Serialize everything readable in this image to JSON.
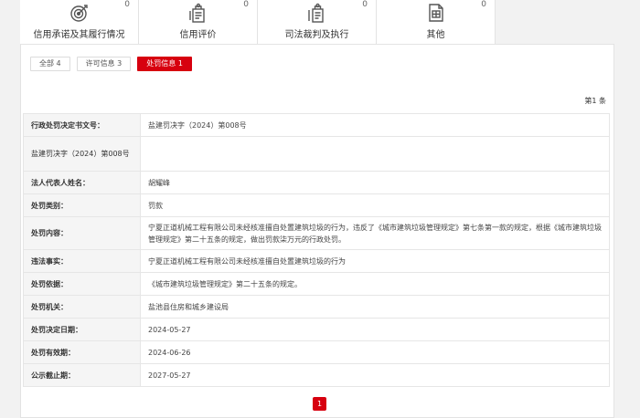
{
  "categories": [
    {
      "label": "信用承诺及其履行情况",
      "count": "0",
      "icon": "commitment-icon"
    },
    {
      "label": "信用评价",
      "count": "0",
      "icon": "evaluation-icon"
    },
    {
      "label": "司法裁判及执行",
      "count": "0",
      "icon": "judicial-icon"
    },
    {
      "label": "其他",
      "count": "0",
      "icon": "other-icon"
    }
  ],
  "filters": [
    {
      "label": "全部 4",
      "active": false
    },
    {
      "label": "许可信息 3",
      "active": false
    },
    {
      "label": "处罚信息 1",
      "active": true
    }
  ],
  "page_info": "第1 条",
  "details": {
    "decision_no_label": "行政处罚决定书文号：",
    "decision_no_value": "盐建罚决字（2024）第008号",
    "sub_row_text": "盐建罚决字（2024）第008号",
    "legal_rep_label": "法人代表人姓名：",
    "legal_rep_value": "胡耀峰",
    "category_label": "处罚类别：",
    "category_value": "罚款",
    "content_label": "处罚内容：",
    "content_value": "宁夏正道机械工程有限公司未经核准擅自处置建筑垃圾的行为，违反了《城市建筑垃圾管理规定》第七条第一款的规定，根据《城市建筑垃圾管理规定》第二十五条的规定，做出罚款柒万元的行政处罚。",
    "facts_label": "违法事实：",
    "facts_value": "宁夏正道机械工程有限公司未经核准擅自处置建筑垃圾的行为",
    "basis_label": "处罚依据：",
    "basis_value": "《城市建筑垃圾管理规定》第二十五条的规定。",
    "authority_label": "处罚机关：",
    "authority_value": "盐池县住房和城乡建设局",
    "decision_date_label": "处罚决定日期：",
    "decision_date_value": "2024-05-27",
    "valid_until_label": "处罚有效期：",
    "valid_until_value": "2024-06-26",
    "publish_until_label": "公示截止期：",
    "publish_until_value": "2027-05-27"
  },
  "pagination": {
    "current": "1"
  },
  "colors": {
    "accent": "#d7000f",
    "icon": "#555555"
  }
}
